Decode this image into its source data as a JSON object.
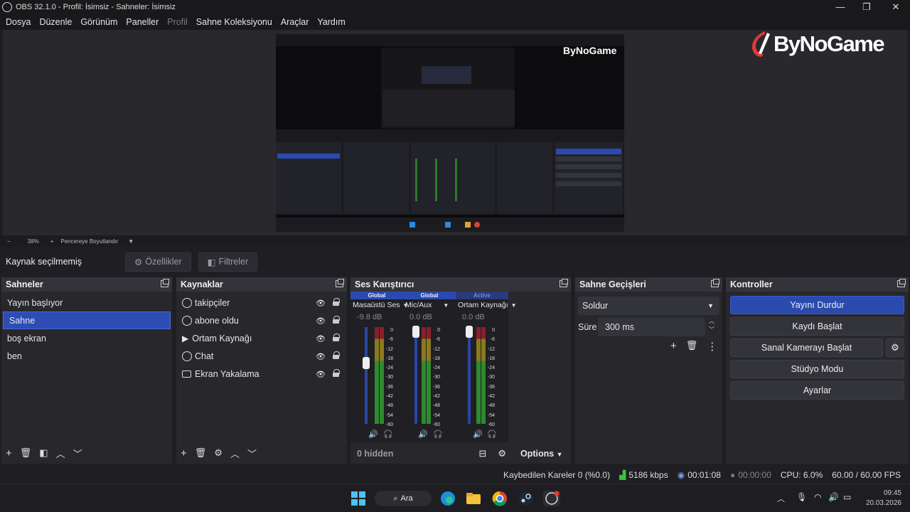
{
  "window": {
    "title": "OBS 32.1.0 - Profil: İsimsiz - Sahneler: İsimsiz",
    "minimize": "—",
    "maximize": "❐",
    "close": "✕"
  },
  "menu": [
    "Dosya",
    "Düzenle",
    "Görünüm",
    "Paneller",
    "Profil",
    "Sahne Koleksiyonu",
    "Araçlar",
    "Yardım"
  ],
  "logo": "ByNoGame",
  "zoom": {
    "minus": "−",
    "value": "38%",
    "plus": "+",
    "mode": "Pencereye Boyutlandır"
  },
  "context": {
    "no_source": "Kaynak seçilmemiş",
    "properties": "Özellikler",
    "filters": "Filtreler"
  },
  "scenes": {
    "title": "Sahneler",
    "items": [
      "Yayın başlıyor",
      "Sahne",
      "boş ekran",
      "ben"
    ],
    "selected": 1
  },
  "sources": {
    "title": "Kaynaklar",
    "items": [
      {
        "label": "takipçiler",
        "icon": "browser-icon"
      },
      {
        "label": "abone oldu",
        "icon": "browser-icon"
      },
      {
        "label": "Ortam Kaynağı",
        "icon": "media-play-icon"
      },
      {
        "label": "Chat",
        "icon": "browser-icon"
      },
      {
        "label": "Ekran Yakalama",
        "icon": "monitor-icon"
      }
    ]
  },
  "mixer": {
    "title": "Ses Karıştırıcı",
    "channels": [
      {
        "tag": "Global",
        "name": "Masaüstü Ses",
        "db": "-9.8 dB",
        "level": 0.68
      },
      {
        "tag": "Global",
        "name": "Mic/Aux",
        "db": "0.0 dB",
        "level": 1.0
      },
      {
        "tag": "Active",
        "name": "Ortam Kaynağı",
        "db": "0.0 dB",
        "level": 1.0
      }
    ],
    "scale": [
      "0",
      "-6",
      "-12",
      "-18",
      "-24",
      "-30",
      "-36",
      "-42",
      "-48",
      "-54",
      "-60"
    ],
    "hidden": "0 hidden",
    "options": "Options"
  },
  "transitions": {
    "title": "Sahne Geçişleri",
    "type": "Soldur",
    "duration_label": "Süre",
    "duration": "300 ms"
  },
  "controls": {
    "title": "Kontroller",
    "stop_stream": "Yayını Durdur",
    "start_record": "Kaydı Başlat",
    "virtual_cam": "Sanal Kamerayı Başlat",
    "studio": "Stüdyo Modu",
    "settings": "Ayarlar"
  },
  "status": {
    "dropped": "Kaybedilen Kareler 0 (%0.0)",
    "bitrate": "5186 kbps",
    "stream_time": "00:01:08",
    "rec_time": "00:00:00",
    "cpu": "CPU: 6.0%",
    "fps": "60.00 / 60.00 FPS"
  },
  "taskbar": {
    "search": "Ara",
    "time": "09:45",
    "date": "20.03.2026"
  }
}
